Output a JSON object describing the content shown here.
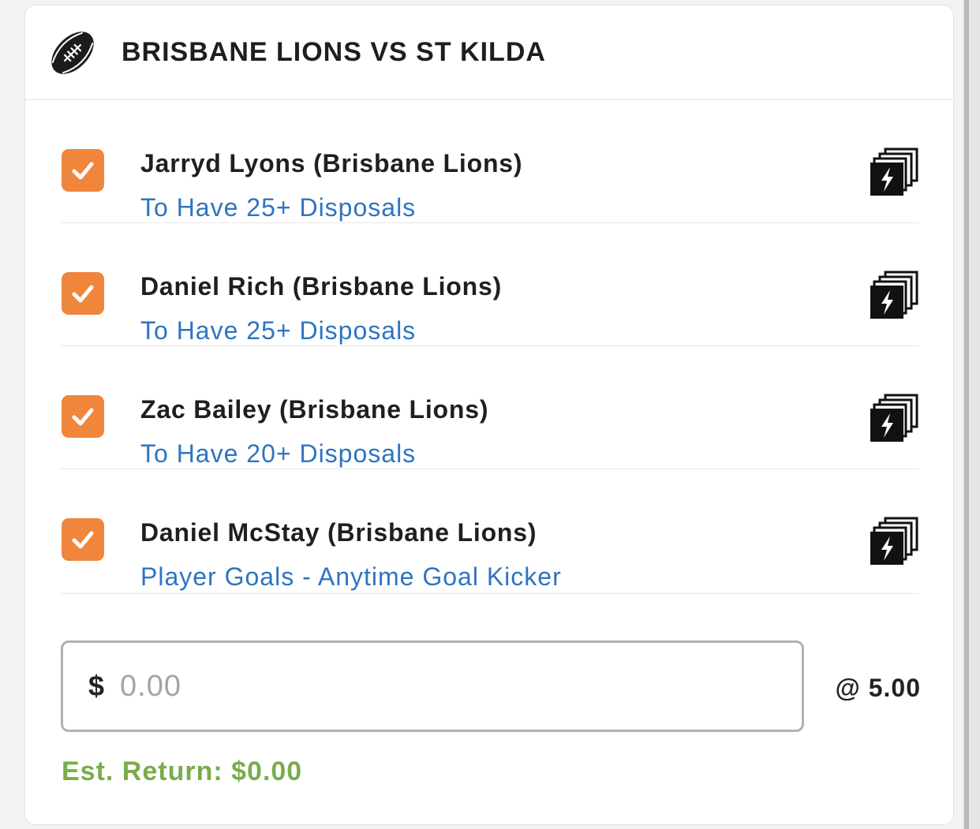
{
  "header": {
    "icon": "football-icon",
    "title": "BRISBANE LIONS VS ST KILDA"
  },
  "selections": [
    {
      "player": "Jarryd Lyons (Brisbane Lions)",
      "market": "To Have 25+ Disposals",
      "checked": true,
      "icon": "same-game-multi-icon"
    },
    {
      "player": "Daniel Rich (Brisbane Lions)",
      "market": "To Have 25+ Disposals",
      "checked": true,
      "icon": "same-game-multi-icon"
    },
    {
      "player": "Zac Bailey (Brisbane Lions)",
      "market": "To Have 20+ Disposals",
      "checked": true,
      "icon": "same-game-multi-icon"
    },
    {
      "player": "Daniel McStay (Brisbane Lions)",
      "market": "Player Goals - Anytime Goal Kicker",
      "checked": true,
      "icon": "same-game-multi-icon"
    }
  ],
  "stake": {
    "currency": "$",
    "placeholder": "0.00",
    "value": ""
  },
  "odds": "@ 5.00",
  "est_return": "Est. Return: $0.00",
  "colors": {
    "checkbox": "#f0853c",
    "market_link": "#2e74c2",
    "est_return": "#7aac4a"
  }
}
